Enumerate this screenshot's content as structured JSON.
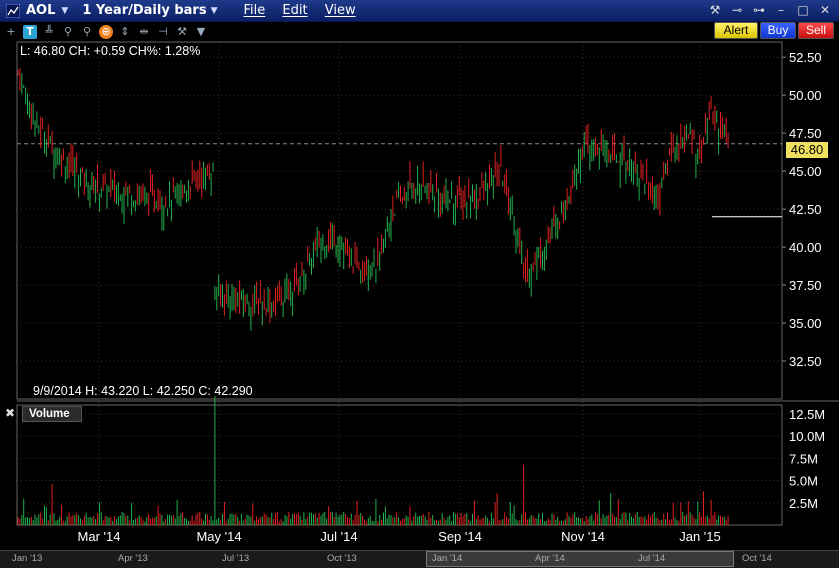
{
  "window": {
    "symbol": "AOL",
    "period": "1 Year/Daily bars",
    "menu": [
      "File",
      "Edit",
      "View"
    ],
    "buttons": {
      "alert": "Alert",
      "buy": "Buy",
      "sell": "Sell"
    }
  },
  "readout": {
    "last": "L: 46.80 CH: +0.59 CH%: 1.28%",
    "bar": "9/9/2014   H: 43.220 L: 42.250 C: 42.290"
  },
  "price_tag": "46.80",
  "volume_label": "Volume",
  "navigator": {
    "labels": [
      "Jan '13",
      "Apr '13",
      "Jul '13",
      "Oct '13",
      "Jan '14",
      "Apr '14",
      "Jul '14",
      "Oct '14"
    ]
  },
  "colors": {
    "up": "#22b14c",
    "down": "#e02020",
    "bg": "#000000",
    "grid": "#3a3a3a"
  },
  "chart_data": {
    "type": "candlestick",
    "price_axis": {
      "ylim": [
        30.0,
        53.5
      ],
      "ticks": [
        "52.50",
        "50.00",
        "47.50",
        "45.00",
        "42.50",
        "40.00",
        "37.50",
        "35.00",
        "32.50"
      ]
    },
    "volume_axis": {
      "ylim": [
        0,
        13.5
      ],
      "ticks": [
        "12.5M",
        "10.0M",
        "7.5M",
        "5.0M",
        "2.5M"
      ]
    },
    "x_labels": [
      "Mar '14",
      "May '14",
      "Jul '14",
      "Sep '14",
      "Nov '14",
      "Jan '15"
    ],
    "last_price": 46.8,
    "marker_level": 42.0
  }
}
